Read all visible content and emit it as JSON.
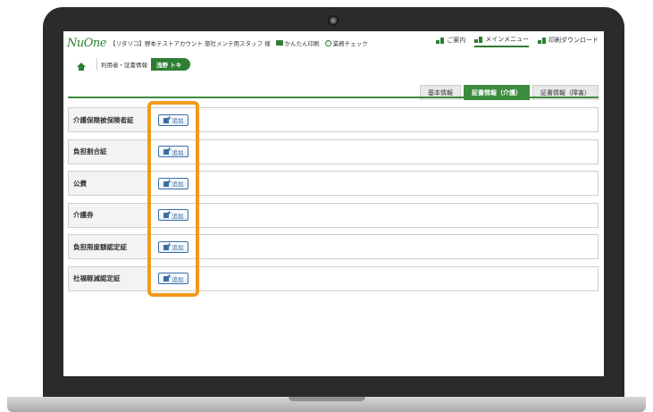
{
  "header": {
    "logo": "NuOne",
    "user_info": "【リタリコ】野本テストアカウント 旅社メンテ用スタッフ 様",
    "print_link": "かんたん印刷",
    "check_link": "業務チェック",
    "nav": [
      {
        "label": "ご案内",
        "icon": "grid-icon",
        "active": false
      },
      {
        "label": "メインメニュー",
        "icon": "grid-icon",
        "active": true
      },
      {
        "label": "印刷ダウンロード",
        "icon": "grid-icon",
        "active": false
      }
    ]
  },
  "breadcrumb": {
    "home_icon": "home-icon",
    "path": "利用者・証書情報",
    "current": "浅野 トキ"
  },
  "tabs": [
    {
      "label": "基本情報",
      "active": false
    },
    {
      "label": "証書情報（介護）",
      "active": true
    },
    {
      "label": "証書情報（障害）",
      "active": false
    }
  ],
  "rows": [
    {
      "label": "介護保険被保険者証",
      "button": "追加"
    },
    {
      "label": "負担割合証",
      "button": "追加"
    },
    {
      "label": "公費",
      "button": "追加"
    },
    {
      "label": "介護券",
      "button": "追加"
    },
    {
      "label": "負担限度額認定証",
      "button": "追加"
    },
    {
      "label": "社福軽減認定証",
      "button": "追加"
    }
  ],
  "colors": {
    "accent_green": "#2e7d32",
    "highlight_orange": "#f29a1b",
    "button_blue": "#3a6ea5"
  }
}
